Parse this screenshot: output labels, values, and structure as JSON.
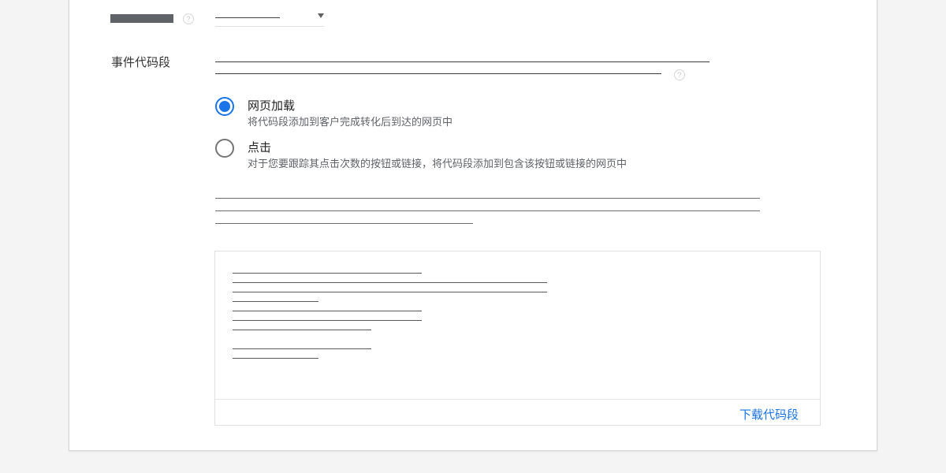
{
  "top_row": {
    "help_symbol": "?"
  },
  "snippet_section": {
    "label": "事件代码段",
    "help_symbol": "?"
  },
  "options": [
    {
      "title": "网页加载",
      "description": "将代码段添加到客户完成转化后到达的网页中",
      "selected": true
    },
    {
      "title": "点击",
      "description": "对于您要跟踪其点击次数的按钮或链接，将代码段添加到包含该按钮或链接的网页中",
      "selected": false
    }
  ],
  "code_box": {
    "download_label": "下载代码段"
  },
  "colors": {
    "accent": "#1a73e8",
    "card_background": "#ffffff",
    "page_background": "#f4f4f4"
  }
}
